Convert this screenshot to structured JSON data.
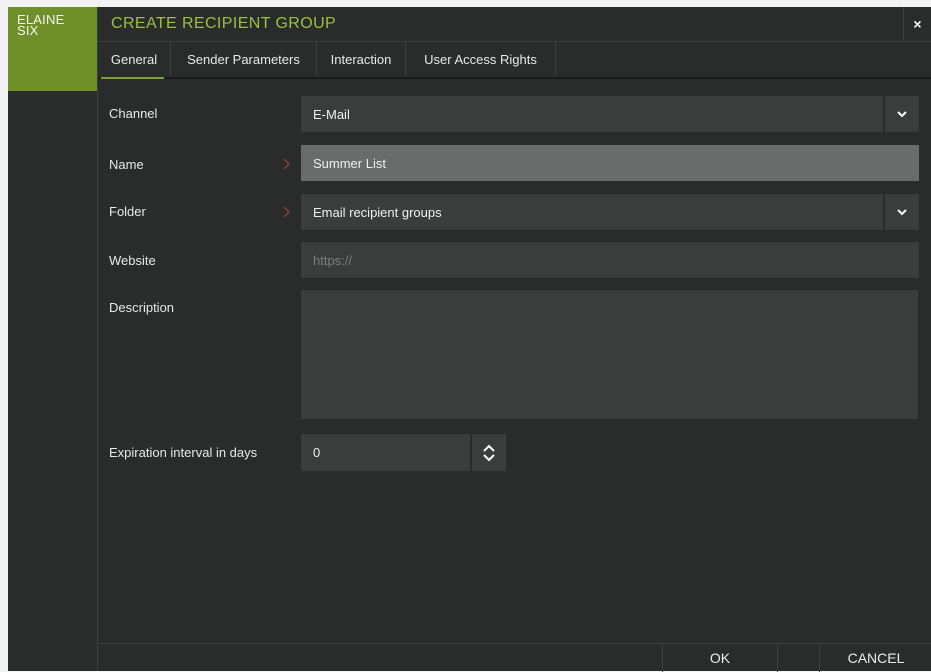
{
  "brand": {
    "line1": "ELAINE",
    "line2": "SIX",
    "color": "#6f8f28"
  },
  "dialog": {
    "title": "CREATE RECIPIENT GROUP",
    "close_glyph": "×",
    "accent": "#9bc13f"
  },
  "tabs": [
    {
      "label": "General",
      "active": true
    },
    {
      "label": "Sender Parameters",
      "active": false
    },
    {
      "label": "Interaction",
      "active": false
    },
    {
      "label": "User Access Rights",
      "active": false
    }
  ],
  "form": {
    "channel": {
      "label": "Channel",
      "value": "E-Mail",
      "icon": "chevron-down-icon"
    },
    "name": {
      "label": "Name",
      "value": "Summer List",
      "required": true
    },
    "folder": {
      "label": "Folder",
      "value": "Email recipient groups",
      "required": true,
      "icon": "chevron-down-icon"
    },
    "website": {
      "label": "Website",
      "value": "",
      "placeholder": "https://"
    },
    "description": {
      "label": "Description",
      "value": ""
    },
    "expiration": {
      "label": "Expiration interval in days",
      "value": "0"
    }
  },
  "footer": {
    "ok_label": "OK",
    "cancel_label": "CANCEL"
  }
}
